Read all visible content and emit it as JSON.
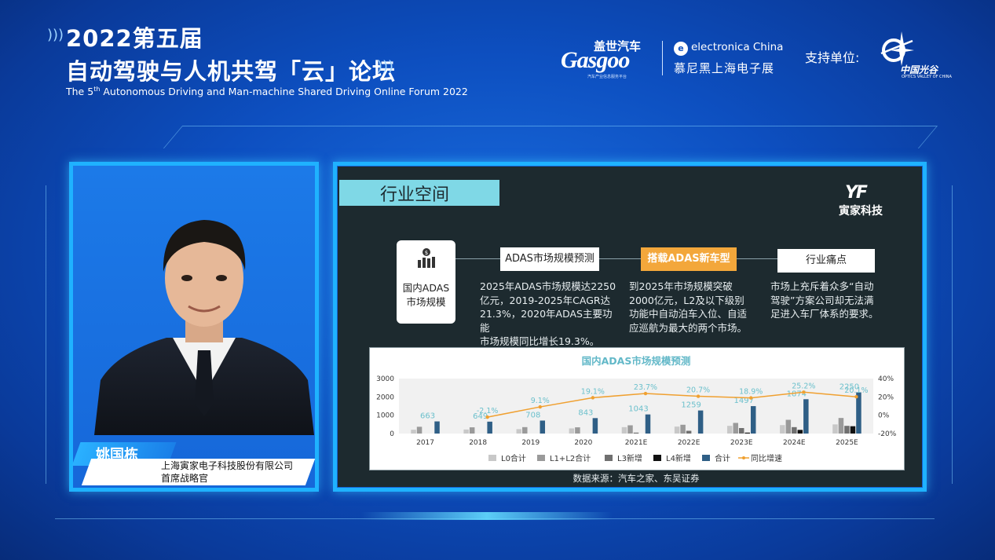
{
  "header": {
    "title_line1": "2022第五届",
    "title_line2": "自动驾驶与人机共驾「云」论坛",
    "subtitle_pre": "The 5",
    "subtitle_sup": "th",
    "subtitle_post": " Autonomous Driving and Man-machine Shared Driving Online Forum 2022"
  },
  "logos": {
    "gasgoo_cn": "盖世汽车",
    "gasgoo": "Gasgoo",
    "gasgoo_tagline": "汽车产业信息服务平台",
    "electronica": "electronica China",
    "electronica_icon": "e",
    "electronica_cn": "慕尼黑上海电子展",
    "support_label": "支持单位:",
    "optics_valley_cn": "中国光谷",
    "optics_valley_en": "OPTICS VALLEY OF CHINA"
  },
  "speaker": {
    "name": "姚国栋",
    "company": "上海寅家电子科技股份有限公司",
    "role": "首席战略官"
  },
  "slide": {
    "title": "行业空间",
    "brand_mark": "YF",
    "brand_name": "寅家科技",
    "card_label_l1": "国内ADAS",
    "card_label_l2": "市场规模",
    "pill1": "ADAS市场规模预测",
    "pill2": "搭载ADAS新车型",
    "pill3": "行业痛点",
    "desc1_l1": "2025年ADAS市场规模达2250",
    "desc1_l2": "亿元，2019-2025年CAGR达",
    "desc1_l3": "21.3%，2020年ADAS主要功能",
    "desc1_l4": "市场规模同比增长19.3%。",
    "desc2_l1": "到2025年市场规模突破",
    "desc2_l2": "2000亿元，L2及以下级别",
    "desc2_l3": "功能中自动泊车入位、自适",
    "desc2_l4": "应巡航为最大的两个市场。",
    "desc3_l1": "市场上充斥着众多“自动",
    "desc3_l2": "驾驶”方案公司却无法满",
    "desc3_l3": "足进入车厂体系的要求。",
    "source": "数据来源：汽车之家、东吴证券"
  },
  "chart_data": {
    "type": "bar",
    "title": "国内ADAS市场规模预测",
    "categories": [
      "2017",
      "2018",
      "2019",
      "2020",
      "2021E",
      "2022E",
      "2023E",
      "2024E",
      "2025E"
    ],
    "y_ticks": [
      "3000",
      "2000",
      "1000",
      "0"
    ],
    "y2_ticks": [
      "40%",
      "20%",
      "0%",
      "-20%"
    ],
    "ylim": [
      0,
      3000
    ],
    "y2lim": [
      -20,
      40
    ],
    "series": [
      {
        "name": "L0合计",
        "color": "#c8c8c8",
        "values": [
          210,
          220,
          240,
          280,
          350,
          380,
          420,
          460,
          500
        ]
      },
      {
        "name": "L1+L2合计",
        "color": "#9a9a9a",
        "values": [
          370,
          340,
          350,
          340,
          450,
          480,
          580,
          750,
          850
        ]
      },
      {
        "name": "L3新增",
        "color": "#707070",
        "values": [
          0,
          0,
          0,
          0,
          50,
          150,
          300,
          350,
          420
        ]
      },
      {
        "name": "L4新增",
        "color": "#111111",
        "values": [
          0,
          0,
          0,
          0,
          0,
          0,
          50,
          200,
          400
        ]
      },
      {
        "name": "合计",
        "color": "#2f5f86",
        "values": [
          663,
          649,
          708,
          843,
          1043,
          1259,
          1497,
          1874,
          2250
        ]
      },
      {
        "name": "同比增速",
        "color": "#f0a030",
        "type": "line",
        "values": [
          null,
          -2.1,
          9.1,
          19.1,
          23.7,
          20.7,
          18.9,
          25.2,
          20.1
        ]
      }
    ],
    "total_labels": [
      "663",
      "649",
      "708",
      "843",
      "1043",
      "1259",
      "1497",
      "1874",
      "2250"
    ],
    "growth_labels": [
      "",
      "-2.1%",
      "9.1%",
      "19.1%",
      "23.7%",
      "20.7%",
      "18.9%",
      "25.2%",
      "20.1%"
    ],
    "legend": [
      "L0合计",
      "L1+L2合计",
      "L3新增",
      "L4新增",
      "合计",
      "同比增速"
    ],
    "legend_placement": "bottom"
  }
}
